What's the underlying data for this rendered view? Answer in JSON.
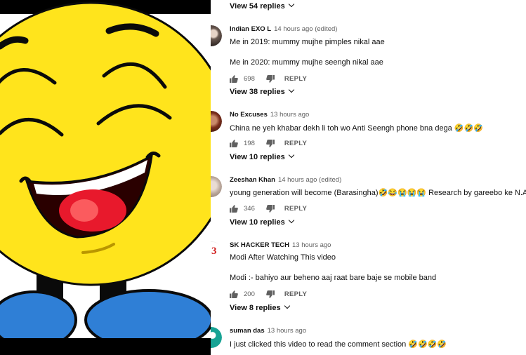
{
  "thread": {
    "top_replies_toggle": "View 54 replies",
    "reply_label": "REPLY",
    "comments": [
      {
        "author": "Indian EXO L",
        "time": "14 hours ago (edited)",
        "lines": [
          "Me in 2019: mummy mujhe pimples nikal aae",
          "Me in 2020: mummy mujhe seengh nikal aae"
        ],
        "likes": "698",
        "replies_toggle": "View 38 replies"
      },
      {
        "author": "No Excuses",
        "time": "13 hours ago",
        "lines": [
          "China ne yeh khabar dekh li toh wo Anti Seengh phone bna dega 🤣🤣🤣"
        ],
        "likes": "198",
        "replies_toggle": "View 10 replies"
      },
      {
        "author": "Zeeshan Khan",
        "time": "14 hours ago (edited)",
        "lines": [
          "young generation will become       (Barasingha)🤣😂😭😭😭 Research by gareebo ke N.A.S.A😭"
        ],
        "likes": "346",
        "replies_toggle": "View 10 replies"
      },
      {
        "author": "SK HACKER TECH",
        "time": "13 hours ago",
        "lines": [
          "Modi After Watching This video",
          "Modi :- bahiyo aur beheno aaj raat bare baje se mobile band"
        ],
        "likes": "200",
        "replies_toggle": "View 8 replies"
      },
      {
        "author": "suman das",
        "time": "13 hours ago",
        "lines": [
          "I just clicked this video to read the comment section 🤣🤣🤣🤣"
        ]
      }
    ]
  },
  "icons": {
    "like": "thumb-up-icon",
    "dislike": "thumb-down-icon",
    "expand": "chevron-down-icon"
  },
  "colors": {
    "emoji_face": "#FFE41C",
    "emoji_outline": "#0a0a0a",
    "shoes": "#2F7FD6",
    "meta_gray": "#606060",
    "text": "#111111"
  }
}
